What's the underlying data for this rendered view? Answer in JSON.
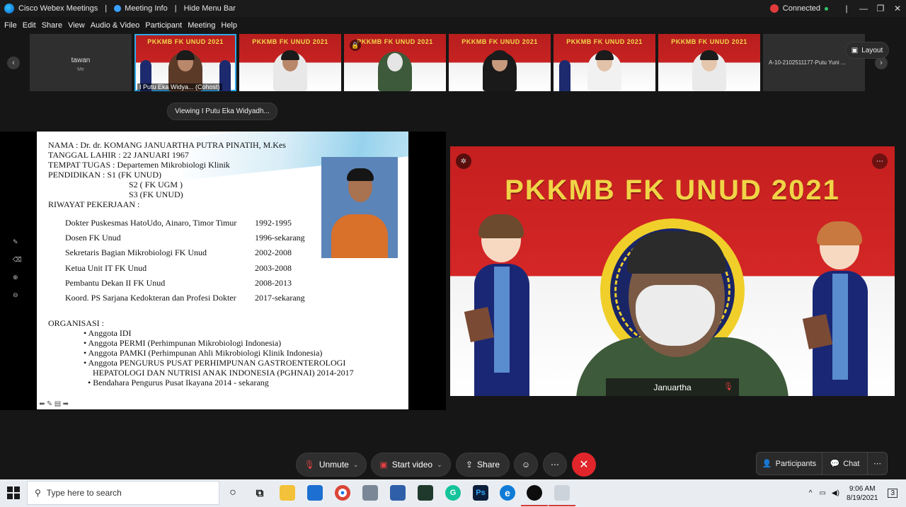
{
  "titlebar": {
    "app_name": "Cisco Webex Meetings",
    "meeting_info": "Meeting Info",
    "hide_menu": "Hide Menu Bar",
    "status": "Connected",
    "minimize": "—",
    "restore": "❐",
    "close": "✕"
  },
  "menubar": [
    "File",
    "Edit",
    "Share",
    "View",
    "Audio & Video",
    "Participant",
    "Meeting",
    "Help"
  ],
  "filmstrip": {
    "prev": "‹",
    "next": "›",
    "banner_text": "PKKMB FK UNUD 2021",
    "self_name": "tawan",
    "self_sub": "Me",
    "cohost_caption": "I Putu Eka Widya... (Cohost)",
    "last_name": "A-10-2102511177-Putu Yuni ...",
    "lock": "🔒",
    "layout_icon": "▣",
    "layout_label": "Layout"
  },
  "viewing": "Viewing I Putu Eka Widyadh...",
  "tools": [
    "✎",
    "⌫",
    "⊕",
    "⊖"
  ],
  "slide": {
    "l1": "NAMA                 :  Dr. dr. KOMANG JANUARTHA PUTRA PINATIH, M.Kes",
    "l2": "TANGGAL LAHIR   :  22 JANUARI 1967",
    "l3": "TEMPAT TUGAS     : Departemen Mikrobiologi Klinik",
    "l4": "PENDIDIKAN         : S1 (FK UNUD)",
    "l5": "S2 ( FK UGM )",
    "l6": "S3 (FK UNUD)",
    "l7": "RIWAYAT  PEKERJAAN          :",
    "jobs": [
      {
        "title": "Dokter Puskesmas HatoUdo, Ainaro, Timor Timur",
        "years": "1992-1995"
      },
      {
        "title": "Dosen FK Unud",
        "years": "1996-sekarang"
      },
      {
        "title": "Sekretaris Bagian Mikrobiologi FK Unud",
        "years": "2002-2008"
      },
      {
        "title": "Ketua Unit IT FK Unud",
        "years": "2003-2008"
      },
      {
        "title": "Pembantu Dekan II FK Unud",
        "years": "2008-2013"
      },
      {
        "title": "Koord. PS Sarjana Kedokteran dan Profesi Dokter",
        "years": "2017-sekarang"
      }
    ],
    "org_head": "ORGANISASI           :",
    "orgs": [
      "•  Anggota IDI",
      "•  Anggota PERMI (Perhimpunan Mikrobiologi Indonesia)",
      "•  Anggota PAMKI (Perhimpunan Ahli Mikrobiologi Klinik Indonesia)",
      "•  Anggota PENGURUS PUSAT PERHIMPUNAN  GASTROENTEROLOGI",
      "HEPATOLOGI DAN NUTRISI ANAK INDONESIA (PGHNAI) 2014-2017",
      "•  Bendahara Pengurus Pusat Ikayana 2014 - sekarang"
    ],
    "nav": "⬅ ✎ ▤ ➡"
  },
  "speaker": {
    "title": "PKKMB FK UNUD 2021",
    "name": "Januartha",
    "mic": "🎙",
    "pin": "✲",
    "more": "⋯"
  },
  "controls": {
    "mic_icon": "🎙",
    "unmute": "Unmute",
    "video_icon": "▣",
    "start_video": "Start video",
    "share_icon": "⇪",
    "share": "Share",
    "emoji": "☺",
    "more": "⋯",
    "end": "✕",
    "caret": "⌄",
    "participants_icon": "👤",
    "participants": "Participants",
    "chat_icon": "💬",
    "chat": "Chat",
    "right_more": "⋯"
  },
  "taskbar": {
    "search_icon": "⚲",
    "search_placeholder": "Type here to search",
    "time": "9:06 AM",
    "date": "8/19/2021",
    "tray_up": "^",
    "notif": "3",
    "taskview": "⧉",
    "cortana": "○",
    "ps_label": "Ps",
    "grammarly_label": "G",
    "chrome_label": "●",
    "edge_label": "e"
  }
}
